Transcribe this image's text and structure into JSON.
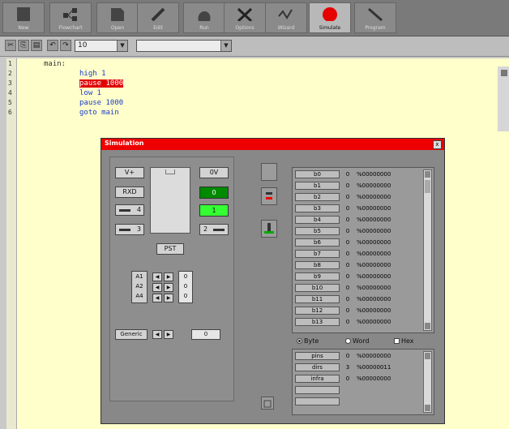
{
  "toolbar": {
    "buttons": [
      {
        "label": "New"
      },
      {
        "label": "Flowchart"
      },
      {
        "label": "Open"
      },
      {
        "label": "Edit"
      },
      {
        "label": "Run"
      },
      {
        "label": "Options"
      },
      {
        "label": "Wizard"
      },
      {
        "label": "Simulate"
      },
      {
        "label": "Program"
      }
    ]
  },
  "format_bar": {
    "font_size": "10",
    "combo_value": ""
  },
  "editor": {
    "line_numbers": [
      "1",
      "2",
      "3",
      "4",
      "5",
      "6"
    ],
    "lines": [
      {
        "text": "main:"
      },
      {
        "text": "high 1"
      },
      {
        "text": "pause 1000"
      },
      {
        "text": "low 1"
      },
      {
        "text": "pause 1000"
      },
      {
        "text": "goto main"
      }
    ],
    "highlight_line": 3
  },
  "simulation": {
    "title": "Simulation",
    "close": "x",
    "chip": {
      "v_plus": "V+",
      "zero_v": "0V",
      "rxd": "RXD",
      "pin_4": "4",
      "pin_3": "3",
      "pin_2": "2",
      "out0": "0",
      "out1": "1",
      "pst": "PST"
    },
    "analog": {
      "labels": [
        "A1",
        "A2",
        "A4"
      ],
      "values": [
        "0",
        "0",
        "0"
      ]
    },
    "generic": {
      "label": "Generic",
      "value": "0"
    },
    "registers": [
      {
        "name": "b0",
        "value": "0",
        "binary": "%00000000"
      },
      {
        "name": "b1",
        "value": "0",
        "binary": "%00000000"
      },
      {
        "name": "b2",
        "value": "0",
        "binary": "%00000000"
      },
      {
        "name": "b3",
        "value": "0",
        "binary": "%00000000"
      },
      {
        "name": "b4",
        "value": "0",
        "binary": "%00000000"
      },
      {
        "name": "b5",
        "value": "0",
        "binary": "%00000000"
      },
      {
        "name": "b6",
        "value": "0",
        "binary": "%00000000"
      },
      {
        "name": "b7",
        "value": "0",
        "binary": "%00000000"
      },
      {
        "name": "b8",
        "value": "0",
        "binary": "%00000000"
      },
      {
        "name": "b9",
        "value": "0",
        "binary": "%00000000"
      },
      {
        "name": "b10",
        "value": "0",
        "binary": "%00000000"
      },
      {
        "name": "b11",
        "value": "0",
        "binary": "%00000000"
      },
      {
        "name": "b12",
        "value": "0",
        "binary": "%00000000"
      },
      {
        "name": "b13",
        "value": "0",
        "binary": "%00000000"
      }
    ],
    "mode": {
      "byte": "Byte",
      "word": "Word",
      "hex": "Hex",
      "selected": "Byte"
    },
    "special_registers": [
      {
        "name": "pins",
        "value": "0",
        "binary": "%00000000"
      },
      {
        "name": "dirs",
        "value": "3",
        "binary": "%00000011"
      },
      {
        "name": "infra",
        "value": "0",
        "binary": "%00000000"
      }
    ]
  },
  "colors": {
    "title_bar": "#ee0000",
    "editor_bg": "#ffffcc",
    "led_green": "#00cc00",
    "keyword_blue": "#1a3cc7"
  }
}
